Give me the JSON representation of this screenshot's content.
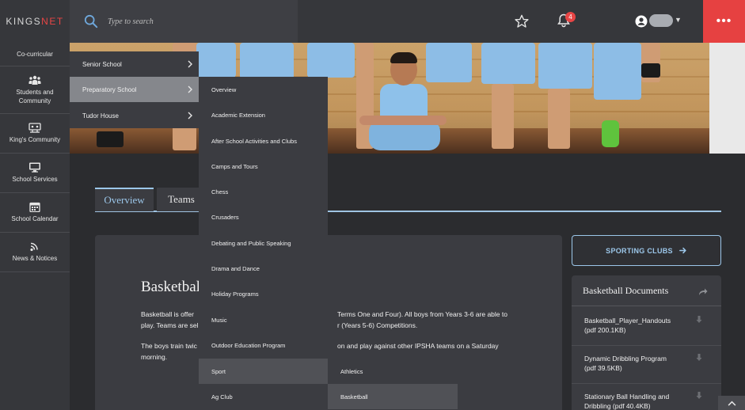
{
  "brand": {
    "logo_prefix": "KINGS",
    "logo_suffix": "NET"
  },
  "search": {
    "placeholder": "Type to search"
  },
  "notifications": {
    "count": "4"
  },
  "sidebar": {
    "items": [
      {
        "label": "Co-curricular",
        "icon": "co-curricular-icon"
      },
      {
        "label": "Students and Community",
        "icon": "people-icon"
      },
      {
        "label": "King's Community",
        "icon": "community-icon"
      },
      {
        "label": "School Services",
        "icon": "monitor-icon"
      },
      {
        "label": "School Calendar",
        "icon": "calendar-icon"
      },
      {
        "label": "News & Notices",
        "icon": "rss-icon"
      }
    ]
  },
  "menu_level1": {
    "items": [
      {
        "label": "Senior School"
      },
      {
        "label": "Preparatory School"
      },
      {
        "label": "Tudor House"
      }
    ],
    "active_index": 1
  },
  "menu_level2": {
    "items": [
      {
        "label": "Overview"
      },
      {
        "label": "Academic Extension"
      },
      {
        "label": "After School Activities and Clubs"
      },
      {
        "label": "Camps and Tours"
      },
      {
        "label": "Chess"
      },
      {
        "label": "Crusaders"
      },
      {
        "label": "Debating and Public Speaking"
      },
      {
        "label": "Drama and Dance"
      },
      {
        "label": "Holiday Programs"
      },
      {
        "label": "Music"
      },
      {
        "label": "Outdoor Education Program"
      },
      {
        "label": "Sport"
      },
      {
        "label": "Ag Club"
      }
    ],
    "active_index": 11
  },
  "menu_level3": {
    "items": [
      {
        "label": "Athletics"
      },
      {
        "label": "Basketball"
      }
    ],
    "active_index": 1
  },
  "tabs": [
    {
      "label": "Overview"
    },
    {
      "label": "Teams"
    }
  ],
  "content": {
    "title": "Basketbal",
    "para1_line1_a": "Basketball is offer",
    "para1_line1_b": "Terms One and Four). All boys from Years 3-6 are able to",
    "para1_line2_a": "play. Teams are sel",
    "para1_line2_b": "r (Years 5-6) Competitions.",
    "para2_line1_a": "The boys train twic",
    "para2_line1_b": "on and play against other IPSHA teams on a Saturday",
    "para2_line2": "morning."
  },
  "sporting_clubs": {
    "label": "SPORTING CLUBS"
  },
  "documents": {
    "title": "Basketball Documents",
    "items": [
      {
        "name": "Basketball_Player_Handouts",
        "size": "(pdf 200.1KB)"
      },
      {
        "name": "Dynamic Dribbling Program",
        "size": "(pdf 39.5KB)"
      },
      {
        "name": "Stationary Ball Handling and",
        "size": "Dribbling (pdf 40.4KB)"
      }
    ]
  },
  "colors": {
    "accent": "#9cc7ea",
    "brand_red": "#e64141",
    "panel": "#3b3c41"
  }
}
